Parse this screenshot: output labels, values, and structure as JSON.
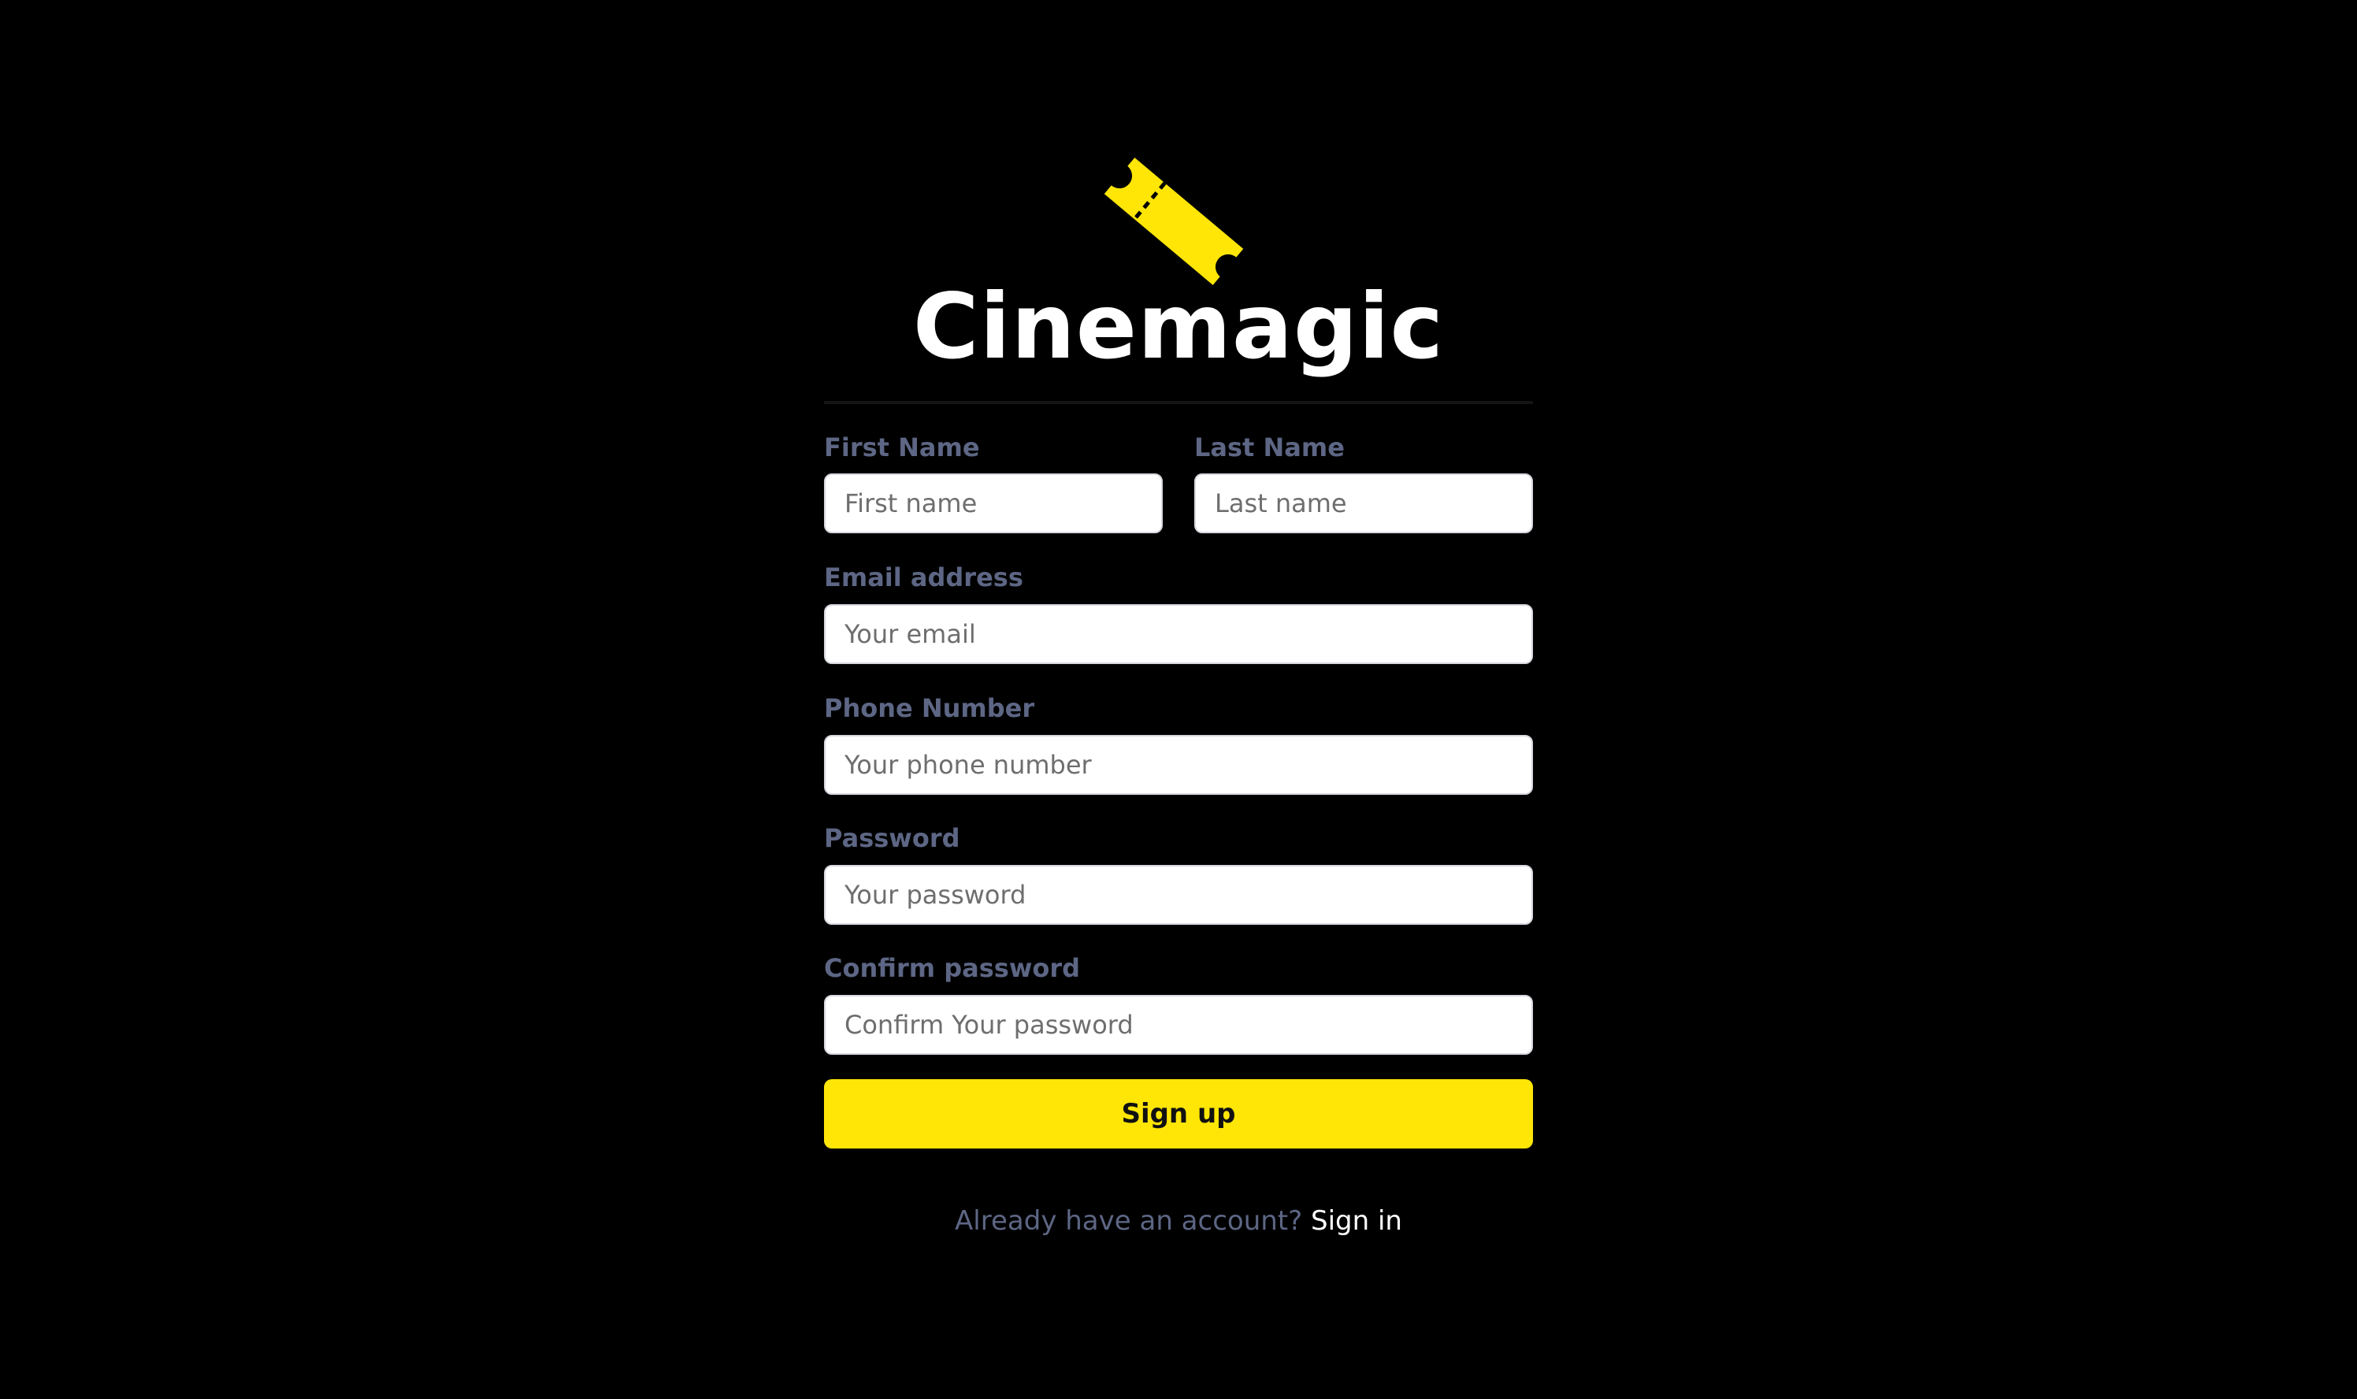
{
  "brand": {
    "name": "Cinemagic",
    "icon": "ticket-icon",
    "accent_color": "#ffe606"
  },
  "form": {
    "first_name": {
      "label": "First Name",
      "placeholder": "First name"
    },
    "last_name": {
      "label": "Last Name",
      "placeholder": "Last name"
    },
    "email": {
      "label": "Email address",
      "placeholder": "Your email"
    },
    "phone": {
      "label": "Phone Number",
      "placeholder": "Your phone number"
    },
    "password": {
      "label": "Password",
      "placeholder": "Your password"
    },
    "confirm_password": {
      "label": "Confirm password",
      "placeholder": "Confirm Your password"
    },
    "submit_label": "Sign up"
  },
  "footer": {
    "prompt": "Already have an account?",
    "link_label": "Sign in"
  }
}
